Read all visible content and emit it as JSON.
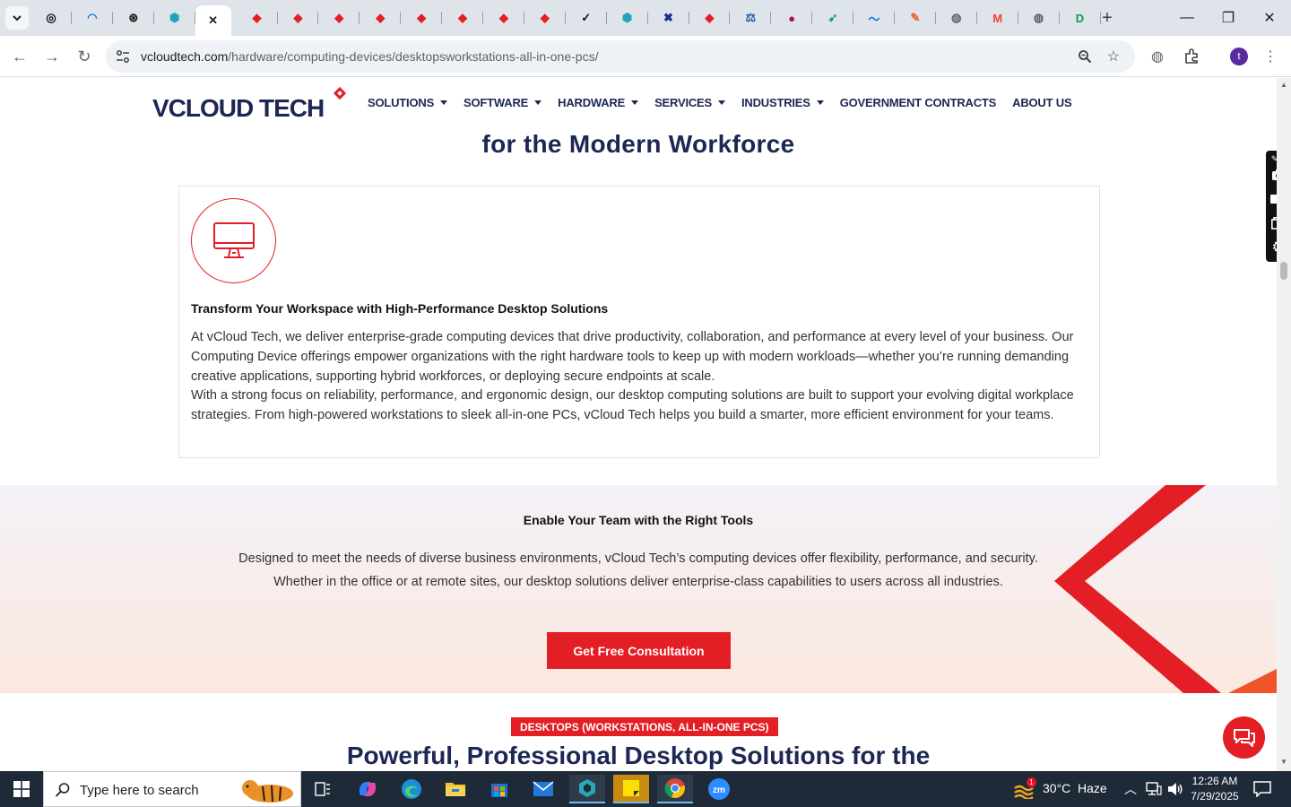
{
  "browser": {
    "tabs": [
      {
        "icon": "openai-icon",
        "glyph": "◎",
        "color": "#111111"
      },
      {
        "icon": "speed-icon",
        "glyph": "◠",
        "color": "#1a73e8"
      },
      {
        "icon": "openai-icon",
        "glyph": "⊛",
        "color": "#111111"
      },
      {
        "icon": "perplexity-icon",
        "glyph": "⬢",
        "color": "#1fa5b5"
      },
      {
        "icon": "close-icon",
        "glyph": "✕",
        "color": "#202124",
        "active": true
      },
      {
        "icon": "vcloud-icon",
        "glyph": "◆",
        "color": "#e31e24"
      },
      {
        "icon": "vcloud-icon",
        "glyph": "◆",
        "color": "#e31e24"
      },
      {
        "icon": "vcloud-icon",
        "glyph": "◆",
        "color": "#e31e24"
      },
      {
        "icon": "vcloud-icon",
        "glyph": "◆",
        "color": "#e31e24"
      },
      {
        "icon": "vcloud-icon",
        "glyph": "◆",
        "color": "#e31e24"
      },
      {
        "icon": "vcloud-icon",
        "glyph": "◆",
        "color": "#e31e24"
      },
      {
        "icon": "vcloud-icon",
        "glyph": "◆",
        "color": "#e31e24"
      },
      {
        "icon": "vcloud-icon",
        "glyph": "◆",
        "color": "#e31e24"
      },
      {
        "icon": "check-icon",
        "glyph": "✓",
        "color": "#111111"
      },
      {
        "icon": "perplexity-icon",
        "glyph": "⬢",
        "color": "#1fa5b5"
      },
      {
        "icon": "x-icon",
        "glyph": "✖",
        "color": "#1b2a8a"
      },
      {
        "icon": "vcloud-icon",
        "glyph": "◆",
        "color": "#e31e24"
      },
      {
        "icon": "scale-icon",
        "glyph": "⚖",
        "color": "#1a5ea8"
      },
      {
        "icon": "ball-icon",
        "glyph": "●",
        "color": "#b0134a"
      },
      {
        "icon": "bolt-icon",
        "glyph": "➹",
        "color": "#19a463"
      },
      {
        "icon": "pulse-icon",
        "glyph": "〜",
        "color": "#1a73e8"
      },
      {
        "icon": "pen-icon",
        "glyph": "✎",
        "color": "#f05a28"
      },
      {
        "icon": "globe-icon",
        "glyph": "◍",
        "color": "#5f6368"
      },
      {
        "icon": "gmail-icon",
        "glyph": "M",
        "color": "#ea4335"
      },
      {
        "icon": "globe-icon",
        "glyph": "◍",
        "color": "#5f6368"
      },
      {
        "icon": "d-icon",
        "glyph": "D",
        "color": "#0f9d58"
      }
    ],
    "url_host": "vcloudtech.com",
    "url_path": "/hardware/computing-devices/desktopsworkstations-all-in-one-pcs/",
    "profile_initial": "t"
  },
  "site": {
    "logo_main": "VCLOUD",
    "logo_accent": "TECH",
    "nav": [
      {
        "label": "SOLUTIONS",
        "dropdown": true
      },
      {
        "label": "SOFTWARE",
        "dropdown": true
      },
      {
        "label": "HARDWARE",
        "dropdown": true
      },
      {
        "label": "SERVICES",
        "dropdown": true
      },
      {
        "label": "INDUSTRIES",
        "dropdown": true
      },
      {
        "label": "GOVERNMENT CONTRACTS",
        "dropdown": false
      },
      {
        "label": "ABOUT US",
        "dropdown": false
      }
    ],
    "hero_title_line2": "for the Modern Workforce",
    "card": {
      "heading": "Transform Your Workspace with High-Performance Desktop Solutions",
      "para1": "At vCloud Tech, we deliver enterprise-grade computing devices that drive productivity, collaboration, and performance at every level of your business. Our Computing Device offerings empower organizations with the right hardware tools to keep up with modern workloads—whether you’re running demanding creative applications, supporting hybrid workforces, or deploying secure endpoints at scale.",
      "para2": "With a strong focus on reliability, performance, and ergonomic design, our desktop computing solutions are built to support your evolving digital workplace strategies. From high-powered workstations to sleek all-in-one PCs, vCloud Tech helps you build a smarter, more efficient environment for your teams."
    },
    "band": {
      "title": "Enable Your Team with the Right Tools",
      "body": "Designed to meet the needs of diverse business environments, vCloud Tech’s computing devices offer flexibility, performance, and security. Whether in the office or at remote sites, our desktop solutions deliver enterprise-class capabilities to users across all industries.",
      "cta": "Get Free Consultation"
    },
    "pill": "DESKTOPS (WORKSTATIONS, ALL-IN-ONE PCS)",
    "section_title_line1": "Powerful, Professional Desktop Solutions for the"
  },
  "taskbar": {
    "search_placeholder": "Type here to search",
    "weather_temp": "30°C",
    "weather_desc": "Haze",
    "weather_badge": "1",
    "time": "12:26 AM",
    "date": "7/29/2025"
  },
  "colors": {
    "brand_navy": "#1d2753",
    "brand_red": "#e31e24",
    "taskbar": "#1f2a38"
  }
}
